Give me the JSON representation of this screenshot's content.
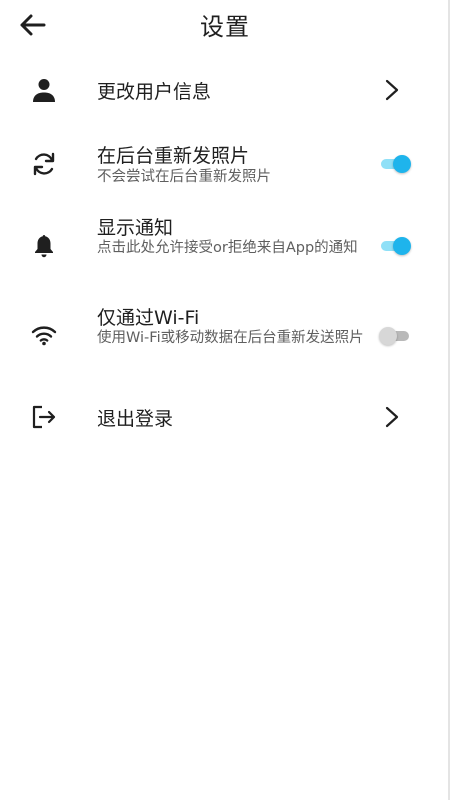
{
  "header": {
    "title": "设置"
  },
  "settings": {
    "profile": {
      "label": "更改用户信息"
    },
    "resend": {
      "label": "在后台重新发照片",
      "description": "不会尝试在后台重新发照片",
      "enabled": true
    },
    "notify": {
      "label": "显示通知",
      "description": "点击此处允许接受or拒绝来自App的通知",
      "enabled": true
    },
    "wifi": {
      "label": "仅通过Wi-Fi",
      "description": "使用Wi-Fi或移动数据在后台重新发送照片",
      "enabled": false
    },
    "logout": {
      "label": "退出登录"
    }
  },
  "colors": {
    "toggle_on": "#1eb4ec",
    "toggle_on_track": "#8fe0f7",
    "toggle_off": "#d7d7d7",
    "text_primary": "#1f1f1f",
    "text_secondary": "#5f5f5f"
  }
}
